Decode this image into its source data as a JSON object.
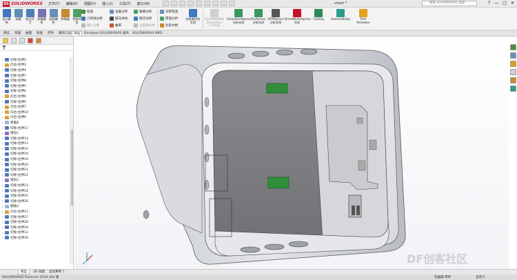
{
  "app": {
    "logo_ds": "DS",
    "logo_text": "SOLIDWORKS",
    "doc_title": "sheet *"
  },
  "menu": [
    "文件(F)",
    "编辑(E)",
    "视图(V)",
    "插入(I)",
    "工具(T)",
    "窗口(W)"
  ],
  "search": {
    "placeholder": "搜索 SOLIDWORKS 帮助"
  },
  "window_controls": [
    "?",
    "—",
    "□",
    "✕"
  ],
  "ribbon": {
    "big": [
      {
        "label": "设计算例",
        "color": "#3e78c2"
      },
      {
        "label": "测量",
        "color": "#5b8db8"
      },
      {
        "label": "标注尺寸",
        "color": "#4a7fb8"
      },
      {
        "label": "质量属性",
        "color": "#7a6fb0"
      },
      {
        "label": "剖面属性",
        "color": "#6b8fb8"
      },
      {
        "label": "传感器",
        "color": "#c98a2e"
      },
      {
        "label": "性能评估",
        "color": "#4e9f63"
      }
    ],
    "group1": [
      "检查",
      "几何体分析",
      "输入诊断"
    ],
    "group2": [
      "误差分析",
      "斑马条纹",
      "曲率"
    ],
    "group3": [
      "拔模分析",
      "底切分析",
      "分型线分析"
    ],
    "group4": [
      "对称检查",
      "厚度分析",
      "比较文档"
    ],
    "compare": "检查激活的文档",
    "addins": [
      {
        "label": "SOLIDWORKS Simulation Costing",
        "color": "#aaaaaa"
      },
      {
        "label": "SimulationXpress 分析向导",
        "color": "#3a9a5b"
      },
      {
        "label": "FloXpress 分析向导",
        "color": "#3a9a5b"
      },
      {
        "label": "DFMXpress 分析向导",
        "color": "#555555"
      },
      {
        "label": "DriveWorksXpress 向导",
        "color": "#c8102e"
      },
      {
        "label": "Costing",
        "color": "#2e8b57"
      },
      {
        "label": "Sustainability",
        "color": "#2a9d8f"
      },
      {
        "label": "Part Reviewer",
        "color": "#e0a21b"
      }
    ]
  },
  "command_tabs": [
    "特征",
    "草图",
    "曲面",
    "钣金",
    "焊件",
    "模具工具",
    "评估",
    "DimXpert",
    "SOLIDWORKS 插件",
    "SOLIDWORKS MBD"
  ],
  "command_tab_active": "评估",
  "tree": [
    "切除-拉伸2",
    "凸台-拉伸3",
    "切除-拉伸4",
    "切除-拉伸7",
    "切除-拉伸8",
    "切除-拉伸5",
    "切除-拉伸6",
    "凸台-拉伸6",
    "切除-拉伸9",
    "凸台-拉伸7",
    "凸台-拉伸10",
    "凸台-拉伸9",
    "草图8",
    "切除-拉伸11",
    "镜向1",
    "切除-拉伸12",
    "切除-拉伸13",
    "切除-拉伸14",
    "切除-拉伸18",
    "切除-拉伸19",
    "切除-拉伸20",
    "切除-拉伸21",
    "切除-拉伸22",
    "镜向2",
    "切除-拉伸23",
    "切除-拉伸24",
    "切除-拉伸25",
    "切除-拉伸26",
    "圆角2",
    "凸台-拉伸11",
    "切除-拉伸27",
    "切除-拉伸28",
    "切除-拉伸29",
    "切除-拉伸12",
    "切除-拉伸30"
  ],
  "bottom_tabs": [
    "模型",
    "3D 视图",
    "运动算例 1"
  ],
  "status": {
    "left": "SOLIDWORKS Premium 2018 x64 版",
    "right1": "在编辑 零件",
    "right2": "自定义"
  },
  "watermark": "DF创客社区",
  "colors": {
    "accent_red": "#c8102e",
    "component_green": "#2f8f3a"
  }
}
